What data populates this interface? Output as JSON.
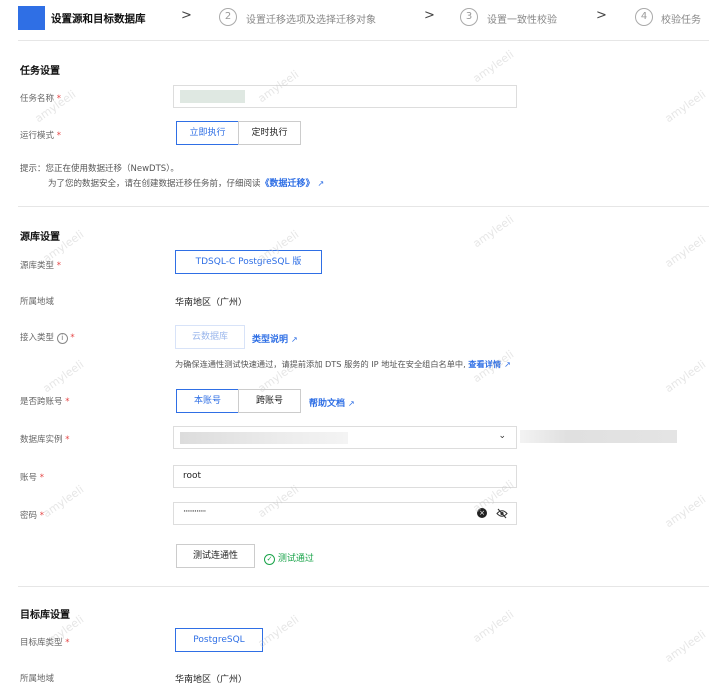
{
  "steps": [
    {
      "label": "设置源和目标数据库"
    },
    {
      "number": "2",
      "label": "设置迁移选项及选择迁移对象"
    },
    {
      "number": "3",
      "label": "设置一致性校验"
    },
    {
      "number": "4",
      "label": "校验任务"
    }
  ],
  "task_section": {
    "title": "任务设置",
    "name_label": "任务名称",
    "mode_label": "运行模式",
    "mode_options": [
      "立即执行",
      "定时执行"
    ],
    "mode_selected": "立即执行",
    "tip_line1": "提示：您正在使用数据迁移（NewDTS）。",
    "tip_line2": "为了您的数据安全，请在创建数据迁移任务前，仔细阅读",
    "tip_link": "《数据迁移》"
  },
  "source_section": {
    "title": "源库设置",
    "type_label": "源库类型",
    "type_value": "TDSQL-C PostgreSQL 版",
    "region_label": "所属地域",
    "region_value": "华南地区（广州）",
    "access_label": "接入类型",
    "access_value": "云数据库",
    "access_link": "类型说明",
    "access_hint": "为确保连通性测试快速通过，请提前添加 DTS 服务的 IP 地址在安全组白名单中,",
    "access_hint_link": "查看详情",
    "cross_label": "是否跨账号",
    "cross_options": [
      "本账号",
      "跨账号"
    ],
    "cross_selected": "本账号",
    "cross_link": "帮助文档",
    "instance_label": "数据库实例",
    "account_label": "账号",
    "account_value": "root",
    "password_label": "密码",
    "password_value": "············",
    "test_button": "测试连通性",
    "test_result": "测试通过"
  },
  "target_section": {
    "title": "目标库设置",
    "type_label": "目标库类型",
    "type_value": "PostgreSQL",
    "region_label": "所属地域",
    "region_value": "华南地区（广州）"
  },
  "watermark": "amyleeli",
  "colors": {
    "accent": "#2f6fe5",
    "required": "#e54545",
    "success": "#1aa44a"
  }
}
